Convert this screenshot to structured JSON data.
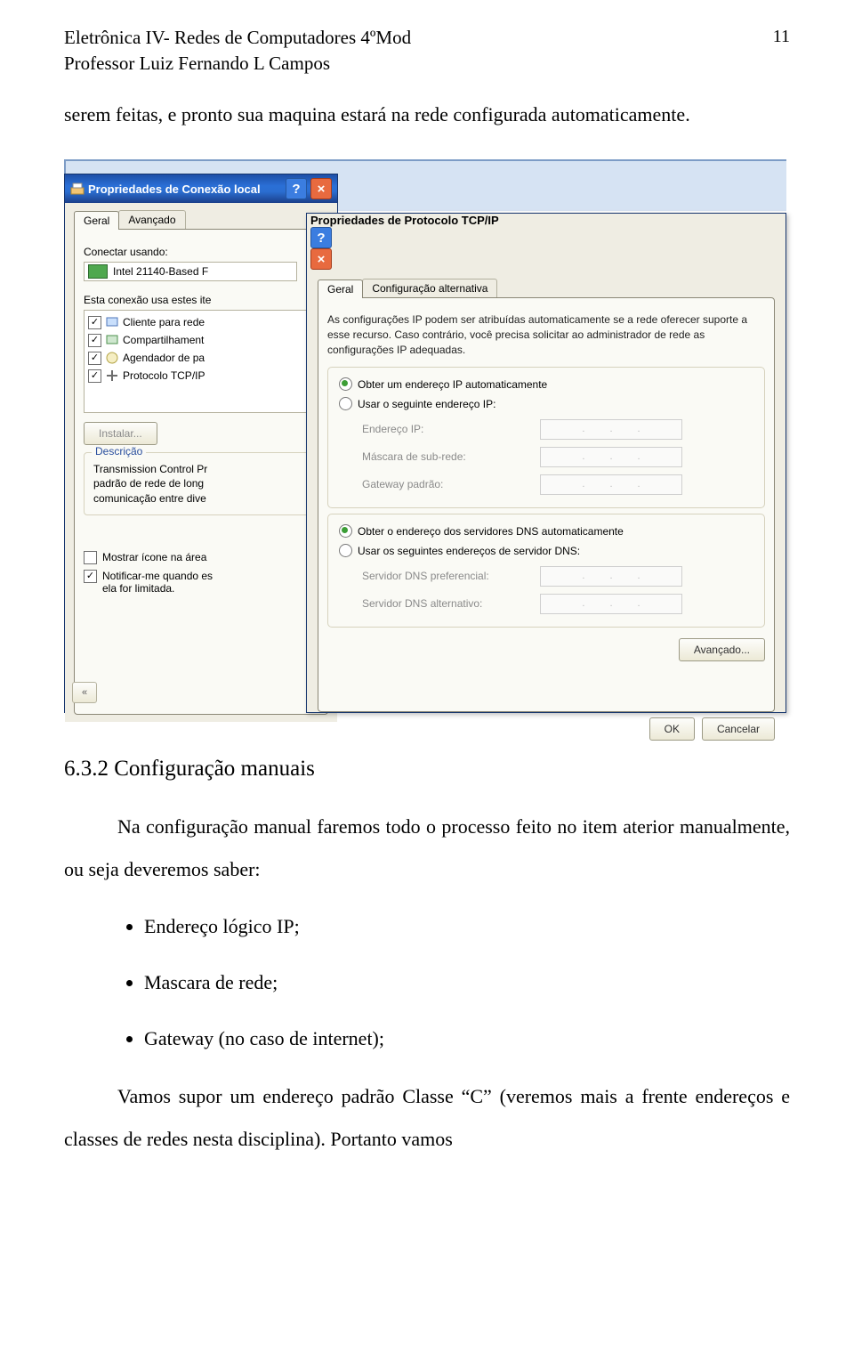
{
  "page": {
    "header1": "Eletrônica IV- Redes de Computadores 4ºMod",
    "header2": "Professor Luiz Fernando L Campos",
    "number": "11"
  },
  "text": {
    "p1": "serem feitas, e pronto sua maquina estará na rede configurada automaticamente.",
    "section": "6.3.2 Configuração manuais",
    "p2": "Na configuração manual faremos todo o processo feito no item aterior manualmente, ou seja deveremos saber:",
    "b1": "Endereço lógico IP;",
    "b2": "Mascara de rede;",
    "b3": "Gateway (no caso de internet);",
    "p3": "Vamos supor um endereço padrão Classe “C” (veremos mais a frente endereços e classes de redes nesta disciplina). Portanto vamos"
  },
  "dlg1": {
    "title": "Propriedades de Conexão local",
    "tabs": {
      "geral": "Geral",
      "avancado": "Avançado"
    },
    "connect_label": "Conectar usando:",
    "adapter": "Intel 21140-Based F",
    "uses_label": "Esta conexão usa estes ite",
    "list": {
      "i1": "Cliente para rede",
      "i2": "Compartilhament",
      "i3": "Agendador de pa",
      "i4": "Protocolo TCP/IP"
    },
    "install": "Instalar...",
    "desc_title": "Descrição",
    "desc_text": "Transmission Control Pr\npadrão de rede de long\ncomunicação entre dive",
    "show_icon": "Mostrar ícone na área",
    "notify": "Notificar-me quando es\nela for limitada.",
    "chevron": "«"
  },
  "dlg2": {
    "title": "Propriedades de Protocolo TCP/IP",
    "tabs": {
      "geral": "Geral",
      "alt": "Configuração alternativa"
    },
    "help": "As configurações IP podem ser atribuídas automaticamente se a rede oferecer suporte a esse recurso. Caso contrário, você precisa solicitar ao administrador de rede as configurações IP adequadas.",
    "r_auto_ip": "Obter um endereço IP automaticamente",
    "r_man_ip": "Usar o seguinte endereço IP:",
    "f_ip": "Endereço IP:",
    "f_mask": "Máscara de sub-rede:",
    "f_gw": "Gateway padrão:",
    "r_auto_dns": "Obter o endereço dos servidores DNS automaticamente",
    "r_man_dns": "Usar os seguintes endereços de servidor DNS:",
    "f_dns1": "Servidor DNS preferencial:",
    "f_dns2": "Servidor DNS alternativo:",
    "advanced": "Avançado...",
    "ok": "OK",
    "cancel": "Cancelar"
  }
}
